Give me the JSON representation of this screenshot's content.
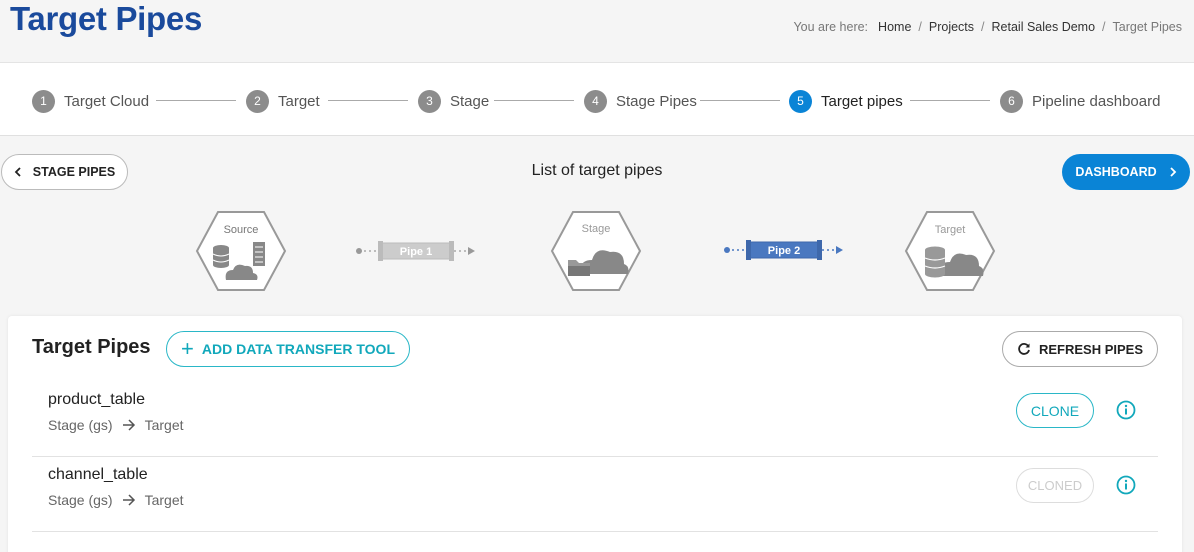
{
  "page": {
    "title": "Target Pipes"
  },
  "breadcrumb": {
    "prefix": "You are here:",
    "items": [
      "Home",
      "Projects",
      "Retail Sales Demo"
    ],
    "current": "Target Pipes"
  },
  "stepper": {
    "steps": [
      {
        "num": "1",
        "label": "Target Cloud",
        "active": false
      },
      {
        "num": "2",
        "label": "Target",
        "active": false
      },
      {
        "num": "3",
        "label": "Stage",
        "active": false
      },
      {
        "num": "4",
        "label": "Stage Pipes",
        "active": false
      },
      {
        "num": "5",
        "label": "Target pipes",
        "active": true
      },
      {
        "num": "6",
        "label": "Pipeline dashboard",
        "active": false
      }
    ]
  },
  "nav": {
    "back_label": "STAGE PIPES",
    "list_title": "List of target pipes",
    "next_label": "DASHBOARD"
  },
  "flow": {
    "source_label": "Source",
    "pipe1_label": "Pipe 1",
    "stage_label": "Stage",
    "pipe2_label": "Pipe 2",
    "target_label": "Target"
  },
  "card": {
    "title": "Target Pipes",
    "add_label": "ADD DATA TRANSFER TOOL",
    "refresh_label": "REFRESH PIPES"
  },
  "pipes": [
    {
      "name": "product_table",
      "from": "Stage (gs)",
      "to": "Target",
      "action": "CLONE",
      "enabled": true
    },
    {
      "name": "channel_table",
      "from": "Stage (gs)",
      "to": "Target",
      "action": "CLONED",
      "enabled": false
    }
  ],
  "colors": {
    "title": "#1a4a9c",
    "primary": "#0a84d6",
    "accent": "#11a8bb",
    "pipe2": "#4a78c0"
  }
}
